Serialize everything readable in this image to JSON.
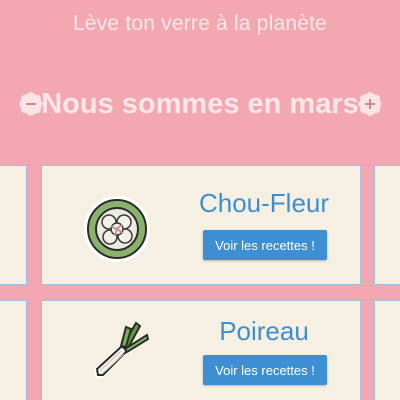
{
  "header": {
    "tagline": "Lève ton verre à la planète"
  },
  "month_nav": {
    "title": "Nous sommes en mars",
    "prev_icon": "minus-circle-icon",
    "next_icon": "plus-circle-icon"
  },
  "cards": [
    {
      "name": "Chou-Fleur",
      "button_label": "Voir les recettes !",
      "icon": "cauliflower-icon"
    },
    {
      "name": "Poireau",
      "button_label": "Voir les recettes !",
      "icon": "leek-icon"
    }
  ],
  "colors": {
    "background": "#f2a7b1",
    "card": "#f6f0e3",
    "accent_blue": "#3d8fd3",
    "header_text": "#fbe7e9"
  }
}
